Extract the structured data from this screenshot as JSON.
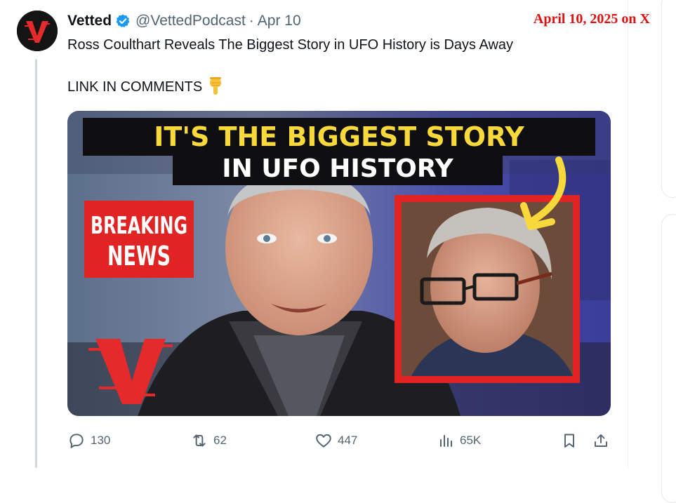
{
  "watermark": "April 10, 2025 on X",
  "author": {
    "name": "Vetted",
    "handle": "@VettedPodcast",
    "separator": "·",
    "date": "Apr 10"
  },
  "tweet": {
    "text": "Ross Coulthart Reveals The Biggest Story in UFO History is Days Away",
    "link_line": "LINK IN COMMENTS",
    "link_emoji_icon": "pointing-down-hand-icon"
  },
  "thumbnail": {
    "headline_line1": "IT'S THE BIGGEST STORY",
    "headline_line2": "IN UFO HISTORY",
    "badge_line1": "BREAKING",
    "badge_line2": "NEWS",
    "logo_letter": "V"
  },
  "actions": {
    "replies": "130",
    "reposts": "62",
    "likes": "447",
    "views": "65K"
  },
  "colors": {
    "verified": "#1d9bf0",
    "watermark": "#e01111",
    "secondary_text": "#536471",
    "accent_yellow": "#f8d93c",
    "badge_red": "#e02323"
  }
}
